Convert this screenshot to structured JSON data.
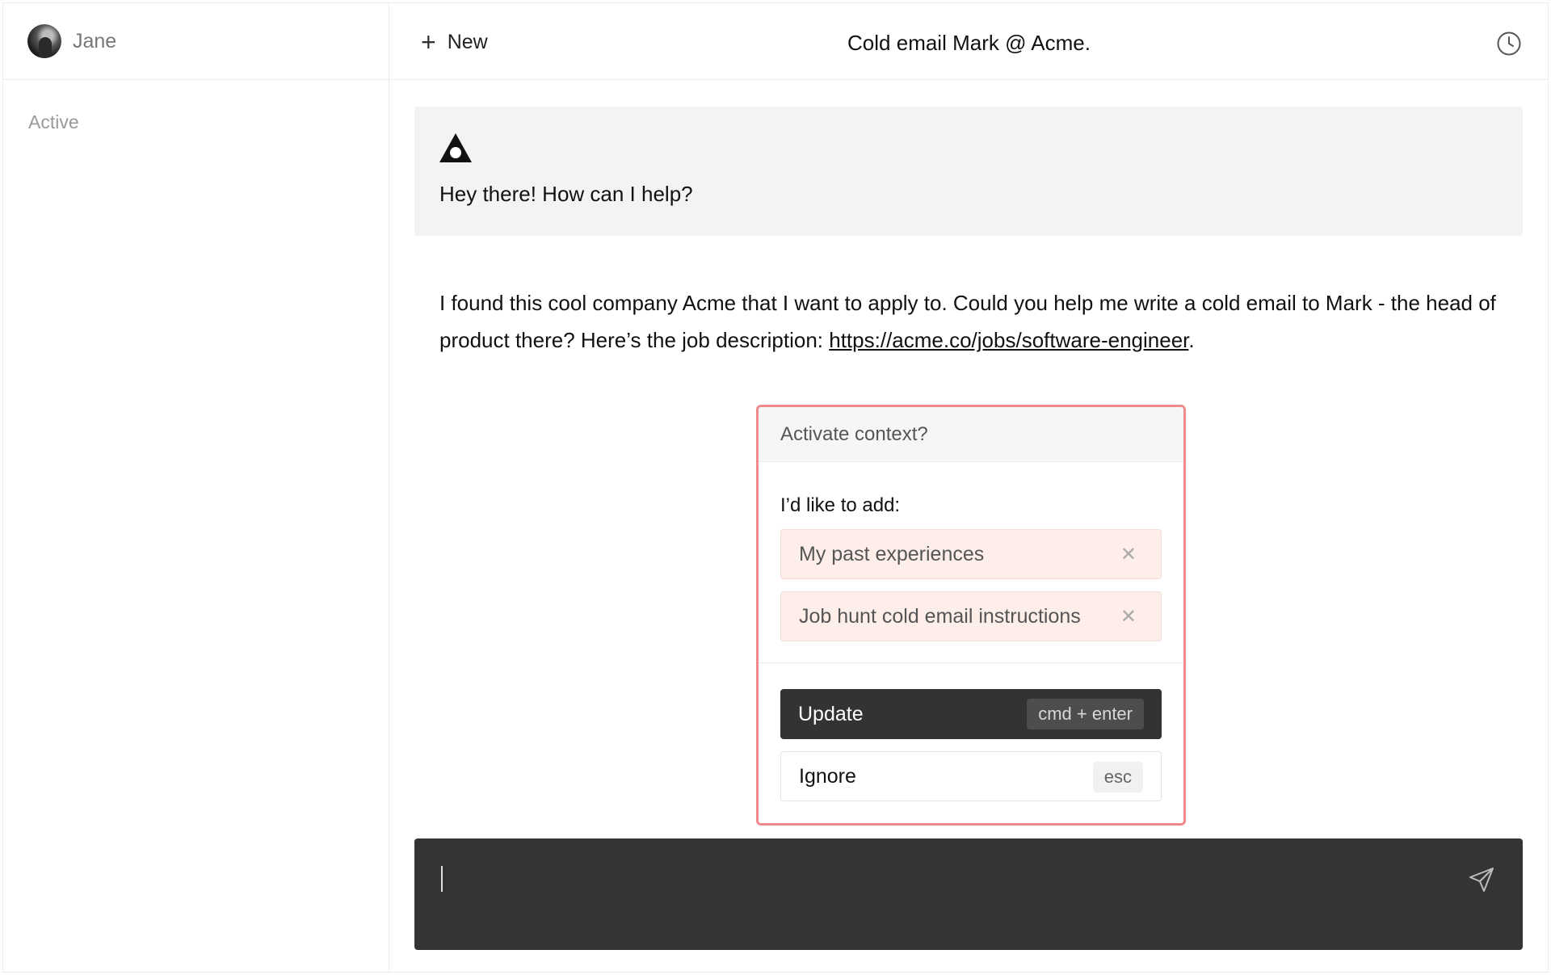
{
  "sidebar": {
    "user_name": "Jane",
    "section_label": "Active"
  },
  "header": {
    "new_label": "New",
    "title": "Cold email Mark @ Acme."
  },
  "messages": {
    "assistant": "Hey there! How can I help?",
    "user_text": "I found this cool company Acme that I want to apply to. Could you help me write a cold email to Mark - the head of product there? Here’s the job description: ",
    "user_link": "https://acme.co/jobs/software-engineer",
    "user_text_end": "."
  },
  "context_modal": {
    "title": "Activate context?",
    "subtitle": "I’d like to add:",
    "chips": [
      {
        "label": "My past experiences"
      },
      {
        "label": "Job hunt cold email instructions"
      }
    ],
    "update_label": "Update",
    "update_shortcut": "cmd + enter",
    "ignore_label": "Ignore",
    "ignore_shortcut": "esc"
  },
  "composer": {
    "value": ""
  },
  "icons": {
    "new": "plus-icon",
    "history": "clock-icon",
    "assistant": "logo-icon",
    "chip_remove": "close-icon",
    "send": "send-icon"
  },
  "colors": {
    "modal_border": "#f08a8e",
    "chip_bg": "#fdeeea",
    "dark": "#333333"
  }
}
